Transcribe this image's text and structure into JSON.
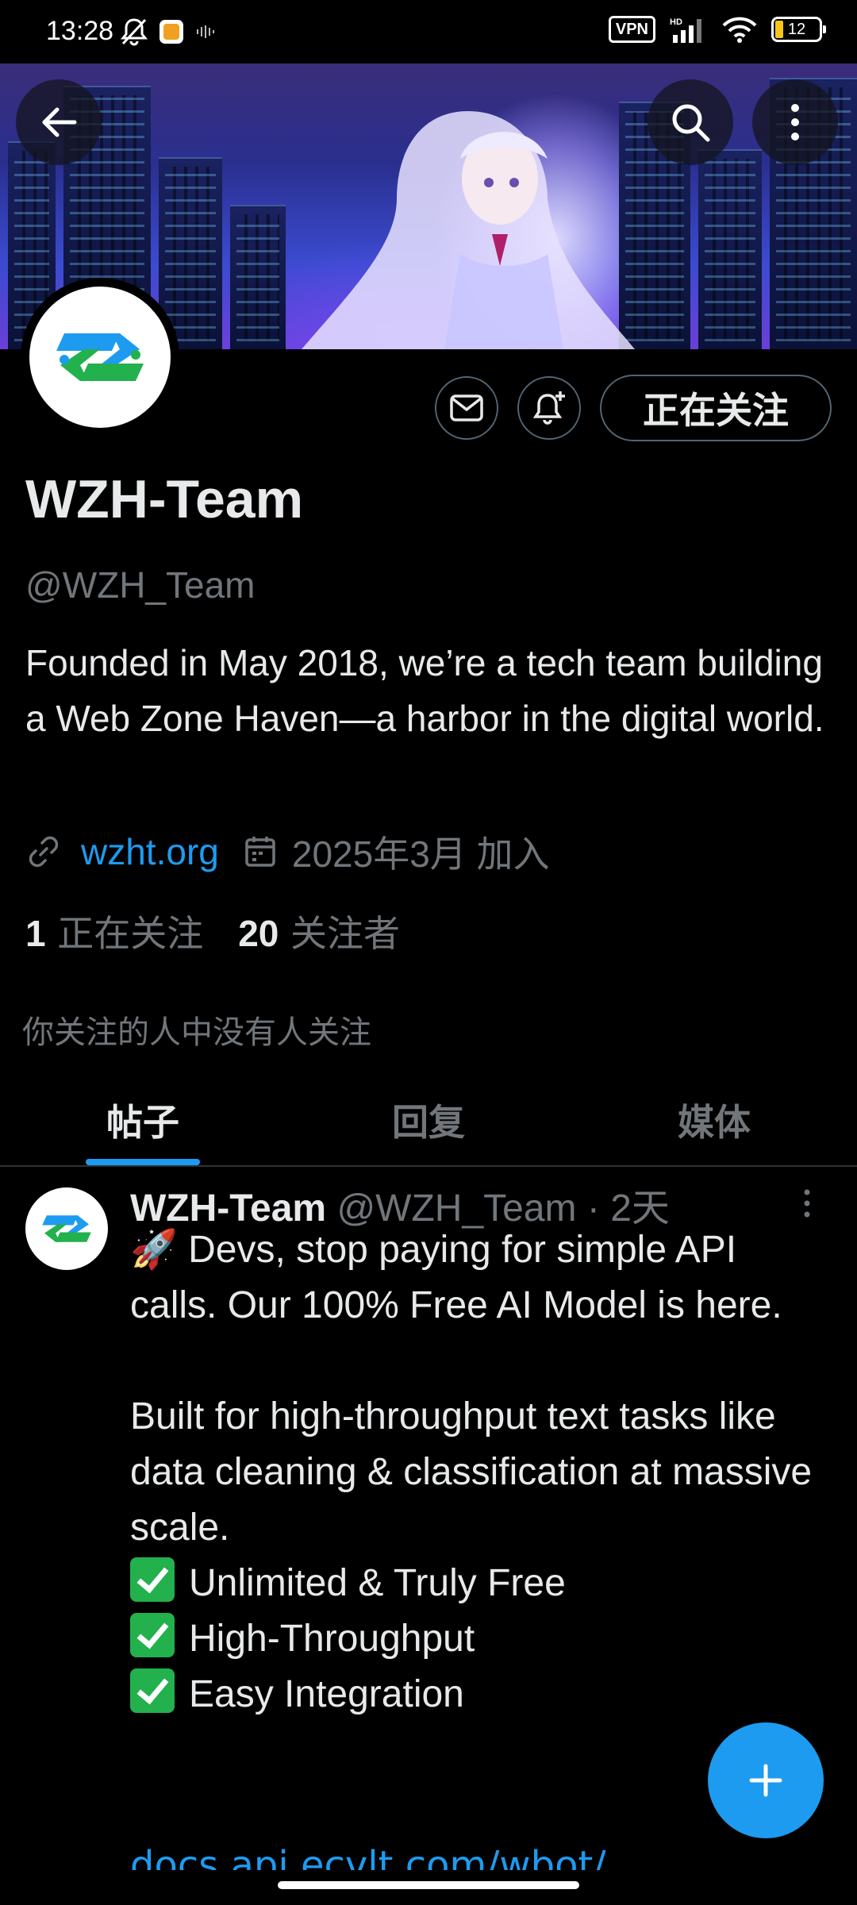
{
  "status_bar": {
    "time": "13:28",
    "vpn": "VPN",
    "hd": "HD",
    "battery": "12"
  },
  "profile": {
    "name": "WZH-Team",
    "handle": "@WZH_Team",
    "bio": "Founded in May 2018, we’re a tech team building a Web Zone Haven—a harbor in the digital world.",
    "website": "wzht.org",
    "joined": "2025年3月 加入",
    "following_count": "1",
    "following_label": "正在关注",
    "followers_count": "20",
    "followers_label": "关注者",
    "mutual_note": "你关注的人中没有人关注",
    "follow_button": "正在关注"
  },
  "tabs": [
    {
      "label": "帖子",
      "active": true
    },
    {
      "label": "回复",
      "active": false
    },
    {
      "label": "媒体",
      "active": false
    }
  ],
  "post": {
    "author": "WZH-Team",
    "handle_time": "@WZH_Team · 2天",
    "line1": "🚀 Devs, stop paying for simple API calls. Our 100% Free AI Model is here.",
    "line2": "Built for high-throughput text tasks like data cleaning & classification at massive scale.",
    "bullets": [
      "Unlimited & Truly Free",
      "High-Throughput",
      "Easy Integration"
    ],
    "link": "docs.api.ecvlt.com/wbot/"
  },
  "icons": {
    "back": "arrow-left-icon",
    "search": "search-icon",
    "more": "more-vertical-icon",
    "message": "mail-icon",
    "notify": "bell-plus-icon",
    "link": "link-icon",
    "calendar": "calendar-icon",
    "compose": "plus-icon"
  },
  "colors": {
    "accent": "#1d9bf0",
    "background": "#000000",
    "muted": "#71767b"
  }
}
